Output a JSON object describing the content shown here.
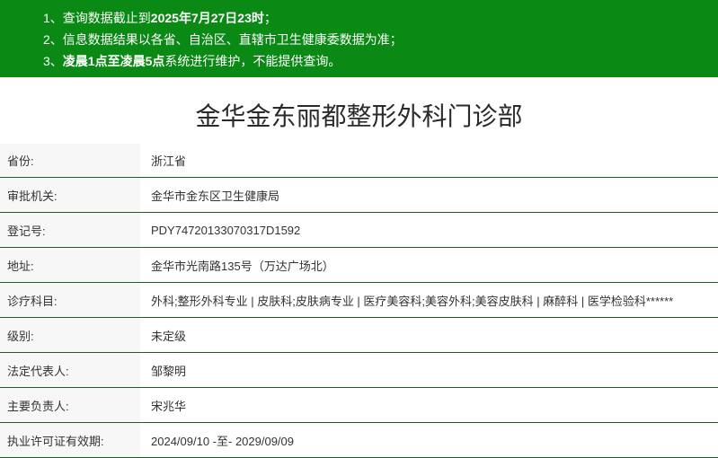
{
  "notice": {
    "line1": {
      "prefix": "1、查询数据截止到",
      "bold": "2025年7月27日23时",
      "suffix": "；"
    },
    "line2": {
      "text": "2、信息数据结果以各省、自治区、直辖市卫生健康委数据为准；"
    },
    "line3": {
      "prefix": "3、",
      "bold": "凌晨1点至凌晨5点",
      "suffix": "系统进行维护，不能提供查询。"
    }
  },
  "title": "金华金东丽都整形外科门诊部",
  "rows": [
    {
      "label": "省份:",
      "value": "浙江省"
    },
    {
      "label": "审批机关:",
      "value": "金华市金东区卫生健康局"
    },
    {
      "label": "登记号:",
      "value": "PDY74720133070317D1592"
    },
    {
      "label": "地址:",
      "value": "金华市光南路135号（万达广场北）"
    },
    {
      "label": "诊疗科目:",
      "value": "外科;整形外科专业 | 皮肤科;皮肤病专业 | 医疗美容科;美容外科;美容皮肤科 | 麻醉科 | 医学检验科******"
    },
    {
      "label": "级别:",
      "value": "未定级"
    },
    {
      "label": "法定代表人:",
      "value": "邹黎明"
    },
    {
      "label": "主要负责人:",
      "value": "宋兆华"
    },
    {
      "label": "执业许可证有效期:",
      "value": "2024/09/10 -至- 2029/09/09"
    }
  ],
  "colors": {
    "banner": "#0a8a14",
    "border": "#1b5e2a",
    "label_bg": "#f7f7f7"
  }
}
